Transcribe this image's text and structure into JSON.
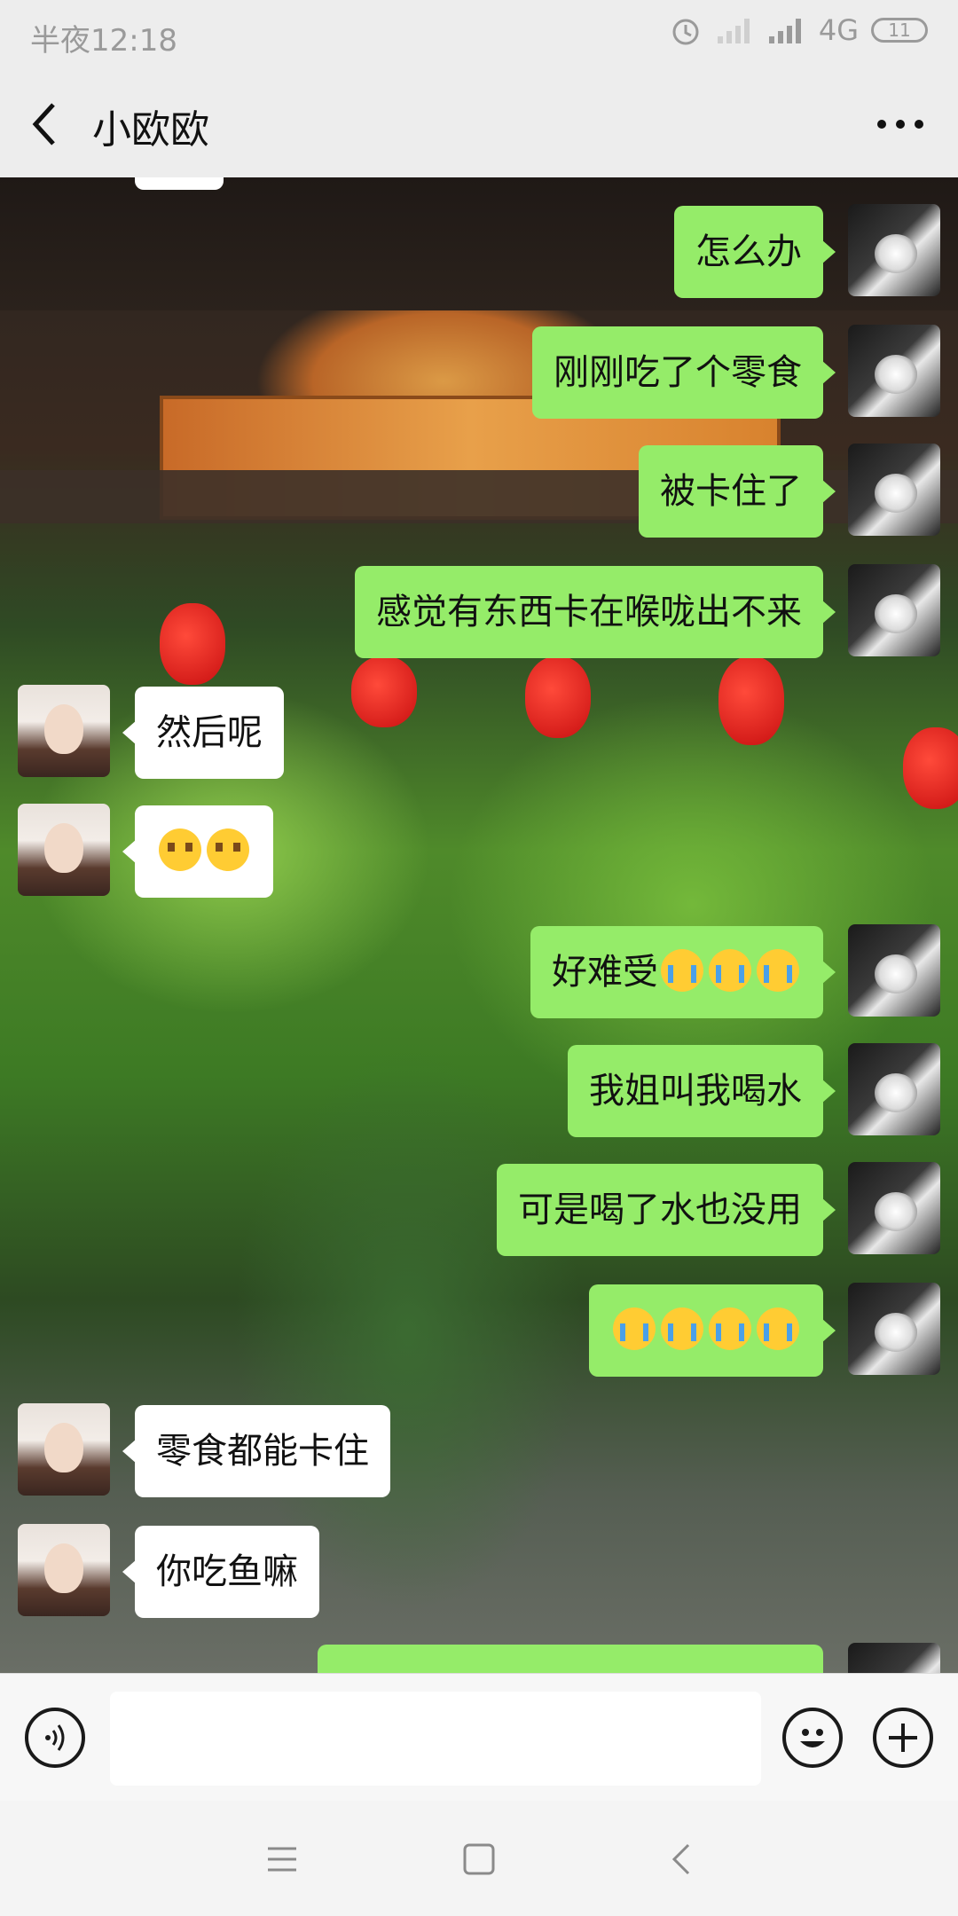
{
  "status_bar": {
    "time": "半夜12:18",
    "network": "4G",
    "battery": "11"
  },
  "header": {
    "title": "小欧欧"
  },
  "messages": [
    {
      "sender": "me",
      "text": "怎么办"
    },
    {
      "sender": "me",
      "text": "刚刚吃了个零食"
    },
    {
      "sender": "me",
      "text": "被卡住了"
    },
    {
      "sender": "me",
      "text": "感觉有东西卡在喉咙出不来"
    },
    {
      "sender": "them",
      "text": "然后呢"
    },
    {
      "sender": "them",
      "text": "",
      "emojis": [
        "flushed",
        "flushed"
      ]
    },
    {
      "sender": "me",
      "text": "好难受",
      "emojis": [
        "loudly-crying",
        "loudly-crying",
        "loudly-crying"
      ]
    },
    {
      "sender": "me",
      "text": "我姐叫我喝水"
    },
    {
      "sender": "me",
      "text": "可是喝了水也没用"
    },
    {
      "sender": "me",
      "text": "",
      "emojis": [
        "loudly-crying",
        "loudly-crying",
        "loudly-crying",
        "loudly-crying"
      ]
    },
    {
      "sender": "them",
      "text": "零食都能卡住"
    },
    {
      "sender": "them",
      "text": "你吃鱼嘛"
    }
  ],
  "input": {
    "value": ""
  },
  "colors": {
    "my_bubble": "#95ec69",
    "their_bubble": "#ffffff",
    "bar_bg": "#ededed"
  }
}
